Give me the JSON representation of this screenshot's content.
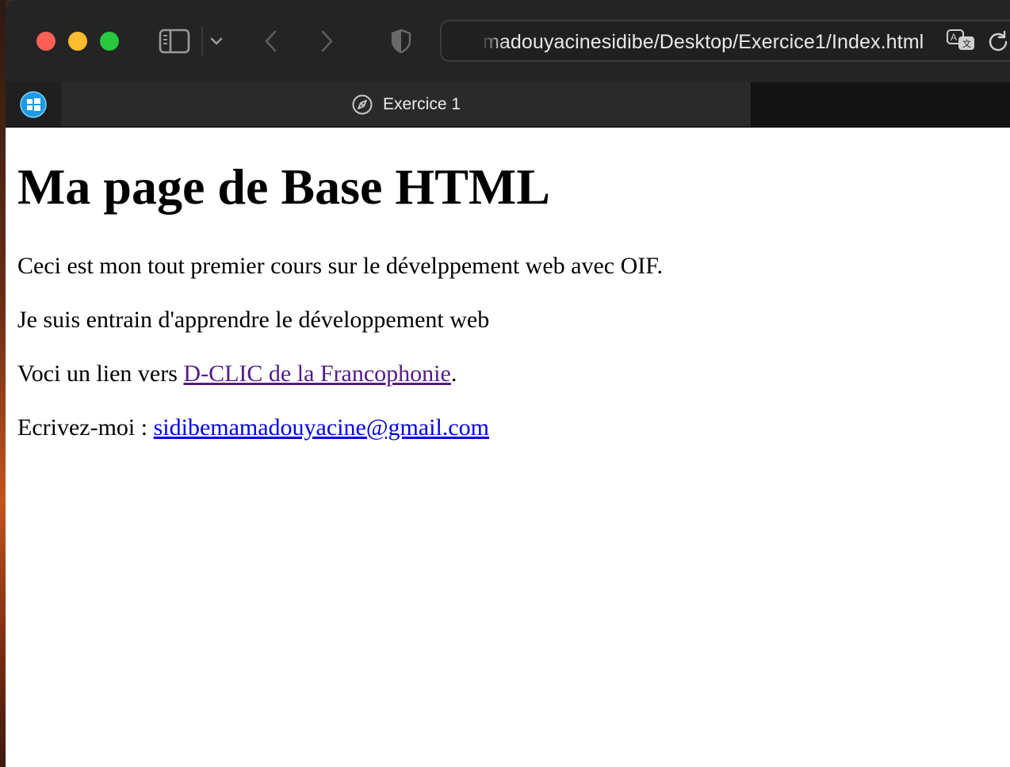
{
  "browser": {
    "url": "madouyacinesidibe/Desktop/Exercice1/Index.html",
    "tab_title": "Exercice 1",
    "icons": [
      "sidebar-icon",
      "chevron-down-icon",
      "back-icon",
      "forward-icon",
      "shield-icon",
      "translate-icon",
      "reload-icon",
      "windows-icon",
      "compass-icon"
    ]
  },
  "page": {
    "heading": "Ma page de Base HTML",
    "paragraph1": "Ceci est mon tout premier cours sur le dévelppement web avec OIF.",
    "paragraph2": "Je suis entrain d'apprendre le développement web",
    "link_intro": "Voci un lien vers ",
    "link_text": "D-CLIC de la Francophonie",
    "link_suffix": ".",
    "contact_intro": "Ecrivez-moi : ",
    "email": "sidibemamadouyacine@gmail.com"
  },
  "colors": {
    "visited_link": "#551a8b",
    "link": "#0000ee",
    "toolbar_bg": "#242424"
  }
}
